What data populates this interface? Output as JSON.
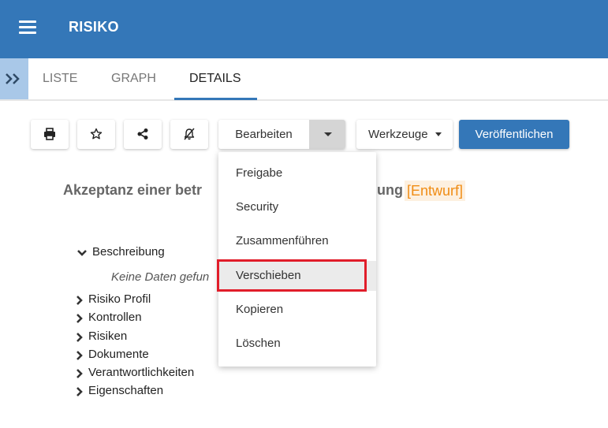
{
  "header": {
    "title": "RISIKO",
    "menu_icon": "hamburger-menu-icon",
    "bg_color": "#3477b8"
  },
  "tabs": [
    {
      "label": "LISTE",
      "active": false
    },
    {
      "label": "GRAPH",
      "active": false
    },
    {
      "label": "DETAILS",
      "active": true
    }
  ],
  "toolbar": {
    "icons": [
      "print-icon",
      "star-icon",
      "share-icon",
      "notification-off-icon"
    ],
    "edit_label": "Bearbeiten",
    "tools_label": "Werkzeuge",
    "publish_label": "Veröffentlichen"
  },
  "document": {
    "title_start": "Akzeptanz einer betr",
    "title_end": "ung",
    "status_badge": "[Entwurf]",
    "badge_color": "#f08c14"
  },
  "tree": {
    "items": [
      {
        "label": "Beschreibung",
        "expanded": true
      },
      {
        "label": "Risiko Profil",
        "expanded": false
      },
      {
        "label": "Kontrollen",
        "expanded": false
      },
      {
        "label": "Risiken",
        "expanded": false
      },
      {
        "label": "Dokumente",
        "expanded": false
      },
      {
        "label": "Verantwortlichkeiten",
        "expanded": false
      },
      {
        "label": "Eigenschaften",
        "expanded": false
      }
    ],
    "empty_text": "Keine Daten gefun"
  },
  "dropdown": {
    "items": [
      {
        "label": "Freigabe"
      },
      {
        "label": "Security"
      },
      {
        "label": "Zusammenführen"
      },
      {
        "label": "Verschieben",
        "highlighted": true
      },
      {
        "label": "Kopieren"
      },
      {
        "label": "Löschen"
      }
    ],
    "highlight_color": "#e11d2a"
  }
}
